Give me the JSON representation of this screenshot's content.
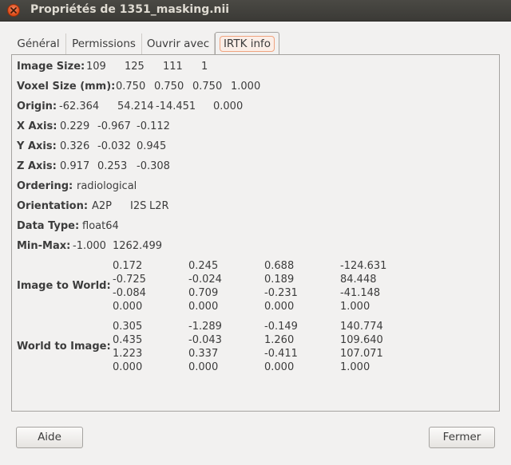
{
  "window": {
    "title": "Propriétés de 1351_masking.nii"
  },
  "tabs": [
    {
      "label": "Général"
    },
    {
      "label": "Permissions"
    },
    {
      "label": "Ouvrir avec"
    },
    {
      "label": "IRTK info",
      "active": true
    }
  ],
  "info": {
    "image_size": {
      "label": "Image Size:",
      "values": [
        "109",
        "125",
        "111",
        "1"
      ]
    },
    "voxel_size": {
      "label": "Voxel Size (mm):",
      "values": [
        "0.750",
        "0.750",
        "0.750",
        "1.000"
      ]
    },
    "origin": {
      "label": "Origin:",
      "values": [
        "-62.364",
        "54.214",
        "-14.451",
        "0.000"
      ]
    },
    "x_axis": {
      "label": "X Axis:",
      "values": [
        "0.229",
        "-0.967",
        "-0.112"
      ]
    },
    "y_axis": {
      "label": "Y Axis:",
      "values": [
        "0.326",
        "-0.032",
        "0.945"
      ]
    },
    "z_axis": {
      "label": "Z Axis:",
      "values": [
        "0.917",
        "0.253",
        "-0.308"
      ]
    },
    "ordering": {
      "label": "Ordering:",
      "value": "radiological"
    },
    "orientation": {
      "label": "Orientation:",
      "values": [
        "A2P",
        "I2S",
        "L2R"
      ]
    },
    "data_type": {
      "label": "Data Type:",
      "value": "float64"
    },
    "min_max": {
      "label": "Min-Max:",
      "values": [
        "-1.000",
        "1262.499"
      ]
    }
  },
  "image_to_world": {
    "label": "Image to World:",
    "rows": [
      [
        "0.172",
        "0.245",
        "0.688",
        "-124.631"
      ],
      [
        "-0.725",
        "-0.024",
        "0.189",
        "84.448"
      ],
      [
        "-0.084",
        "0.709",
        "-0.231",
        "-41.148"
      ],
      [
        "0.000",
        "0.000",
        "0.000",
        "1.000"
      ]
    ]
  },
  "world_to_image": {
    "label": "World to Image:",
    "rows": [
      [
        "0.305",
        "-1.289",
        "-0.149",
        "140.774"
      ],
      [
        "0.435",
        "-0.043",
        "1.260",
        "109.640"
      ],
      [
        "1.223",
        "0.337",
        "-0.411",
        "107.071"
      ],
      [
        "0.000",
        "0.000",
        "0.000",
        "1.000"
      ]
    ]
  },
  "buttons": {
    "help": "Aide",
    "close": "Fermer"
  },
  "colors": {
    "accent": "#dd4814",
    "titlebar": "#3b3a36",
    "background": "#f2f1f0"
  },
  "icons": {
    "close": "close-icon"
  }
}
